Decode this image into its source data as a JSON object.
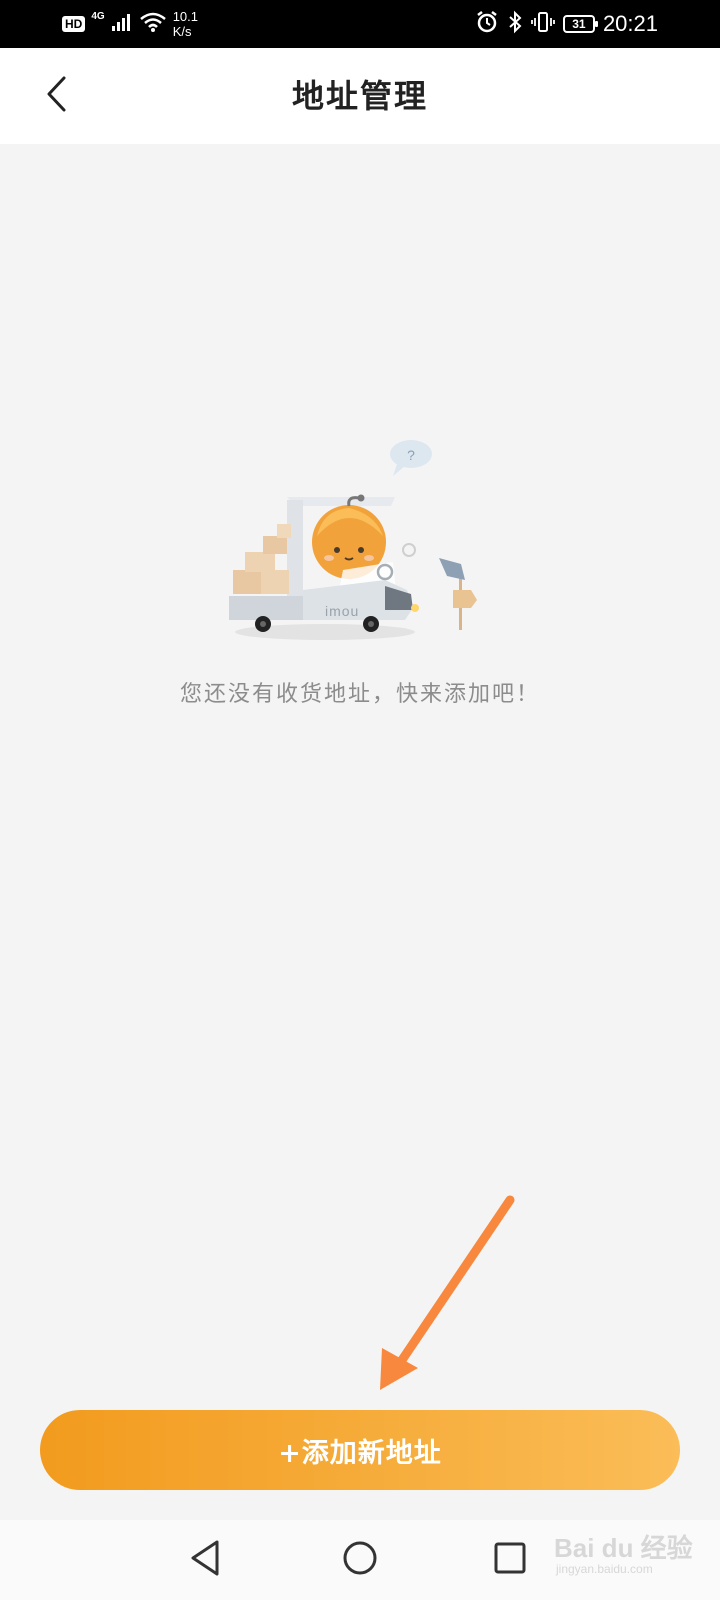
{
  "status_bar": {
    "hd_label": "HD",
    "network_gen": "4G",
    "speed_value": "10.1",
    "speed_unit": "K/s",
    "battery_level": "31",
    "time": "20:21"
  },
  "header": {
    "title": "地址管理",
    "back_icon": "chevron-left-icon"
  },
  "empty_state": {
    "illustration_icon": "delivery-truck-illustration",
    "truck_brand": "imou",
    "bubble_text": "?",
    "message": "您还没有收货地址，快来添加吧！"
  },
  "actions": {
    "add_address_label": "+添加新地址",
    "gradient_start": "#f29b1e",
    "gradient_end": "#fbbd58"
  },
  "annotation": {
    "arrow_color": "#f7883e"
  },
  "nav_bar": {
    "back_icon": "triangle-back-icon",
    "home_icon": "circle-home-icon",
    "recents_icon": "square-recents-icon"
  },
  "watermark": {
    "logo_text": "Bai du 经验",
    "url": "jingyan.baidu.com"
  }
}
